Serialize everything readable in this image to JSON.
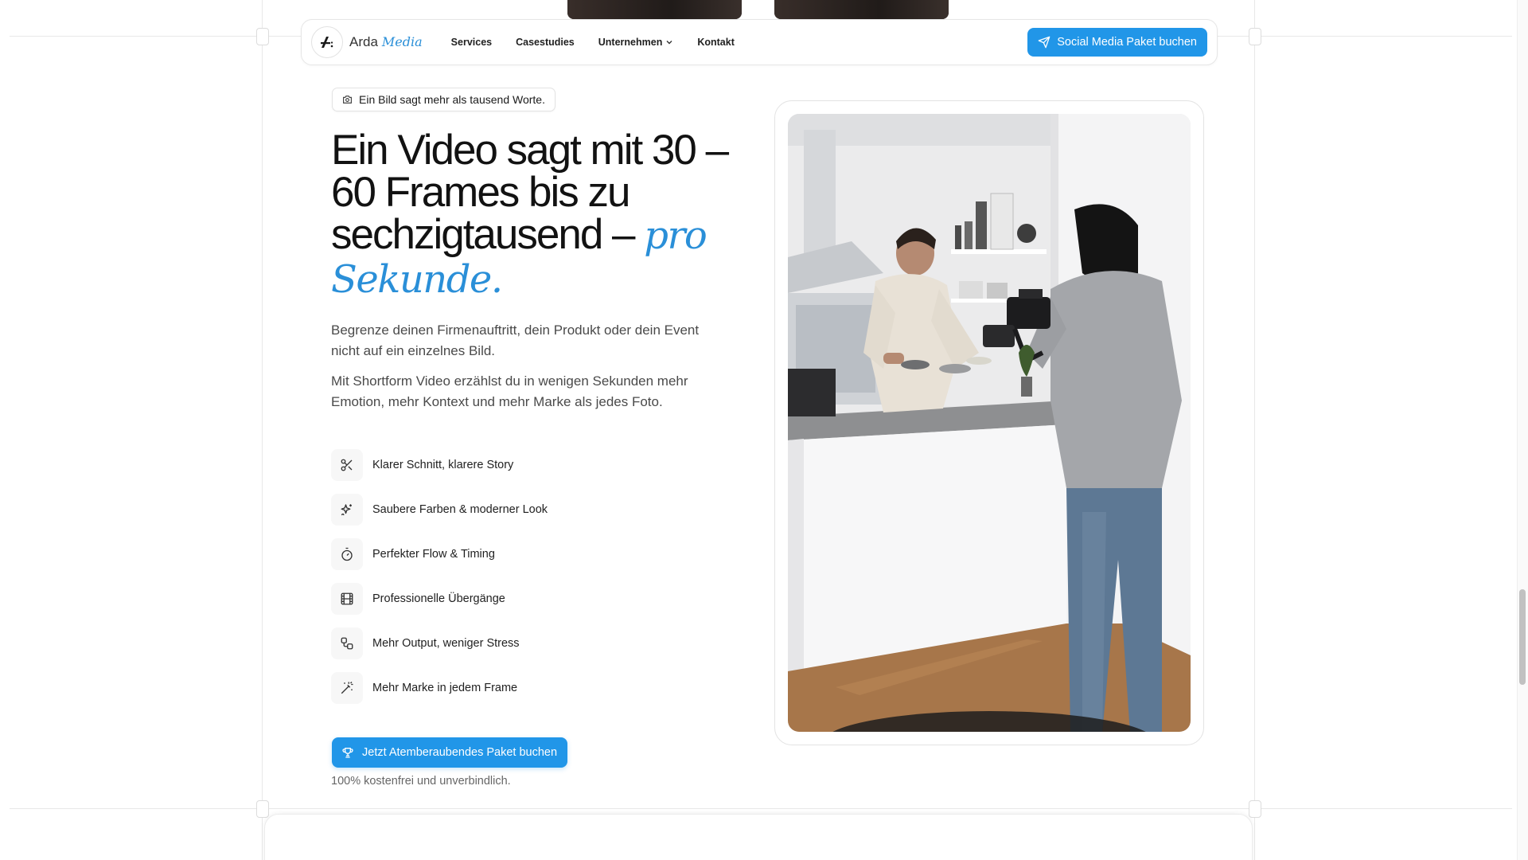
{
  "brand": {
    "name": "Arda",
    "accent": "Media",
    "accent_color": "#2a8fd8"
  },
  "nav": {
    "links": [
      {
        "label": "Services"
      },
      {
        "label": "Casestudies"
      },
      {
        "label": "Unternehmen",
        "has_dropdown": true
      },
      {
        "label": "Kontakt"
      }
    ],
    "cta_label": "Social Media Paket buchen",
    "cta_icon": "send-icon",
    "cta_color": "#2196e8"
  },
  "hero": {
    "pill": "Ein Bild sagt mehr als tausend Worte.",
    "pill_icon": "camera-icon",
    "headline_main": "Ein Video sagt mit 30 – 60 Frames bis zu sechzigtausend –",
    "headline_accent": "pro Sekunde.",
    "paragraph_1": "Begrenze deinen Firmenauftritt, dein Produkt oder dein Event nicht auf ein einzelnes Bild.",
    "paragraph_2": "Mit Shortform Video erzählst du in wenigen Sekunden mehr Emotion, mehr Kontext und mehr Marke als jedes Foto.",
    "features": [
      {
        "icon": "scissors-icon",
        "label": "Klarer Schnitt, klarere Story"
      },
      {
        "icon": "sparkles-icon",
        "label": "Saubere Farben & moderner Look"
      },
      {
        "icon": "timer-icon",
        "label": "Perfekter Flow & Timing"
      },
      {
        "icon": "film-icon",
        "label": "Professionelle Übergänge"
      },
      {
        "icon": "workflow-icon",
        "label": "Mehr Output, weniger Stress"
      },
      {
        "icon": "magic-wand-icon",
        "label": "Mehr Marke in jedem Frame"
      }
    ],
    "cta_label": "Jetzt Atemberaubendes Paket buchen",
    "cta_icon": "trophy-icon",
    "cta_note": "100% kostenfrei und unverbindlich."
  },
  "media": {
    "description_icon": "video-photo"
  }
}
